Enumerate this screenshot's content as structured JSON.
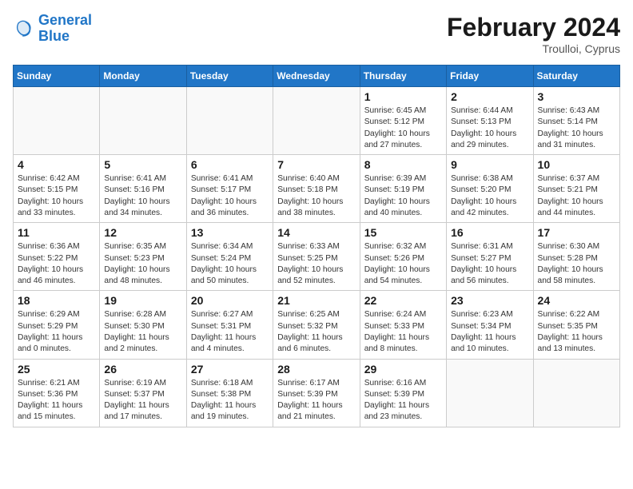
{
  "header": {
    "logo_line1": "General",
    "logo_line2": "Blue",
    "month_year": "February 2024",
    "location": "Troulloi, Cyprus"
  },
  "days_of_week": [
    "Sunday",
    "Monday",
    "Tuesday",
    "Wednesday",
    "Thursday",
    "Friday",
    "Saturday"
  ],
  "weeks": [
    [
      {
        "day": "",
        "info": ""
      },
      {
        "day": "",
        "info": ""
      },
      {
        "day": "",
        "info": ""
      },
      {
        "day": "",
        "info": ""
      },
      {
        "day": "1",
        "info": "Sunrise: 6:45 AM\nSunset: 5:12 PM\nDaylight: 10 hours and 27 minutes."
      },
      {
        "day": "2",
        "info": "Sunrise: 6:44 AM\nSunset: 5:13 PM\nDaylight: 10 hours and 29 minutes."
      },
      {
        "day": "3",
        "info": "Sunrise: 6:43 AM\nSunset: 5:14 PM\nDaylight: 10 hours and 31 minutes."
      }
    ],
    [
      {
        "day": "4",
        "info": "Sunrise: 6:42 AM\nSunset: 5:15 PM\nDaylight: 10 hours and 33 minutes."
      },
      {
        "day": "5",
        "info": "Sunrise: 6:41 AM\nSunset: 5:16 PM\nDaylight: 10 hours and 34 minutes."
      },
      {
        "day": "6",
        "info": "Sunrise: 6:41 AM\nSunset: 5:17 PM\nDaylight: 10 hours and 36 minutes."
      },
      {
        "day": "7",
        "info": "Sunrise: 6:40 AM\nSunset: 5:18 PM\nDaylight: 10 hours and 38 minutes."
      },
      {
        "day": "8",
        "info": "Sunrise: 6:39 AM\nSunset: 5:19 PM\nDaylight: 10 hours and 40 minutes."
      },
      {
        "day": "9",
        "info": "Sunrise: 6:38 AM\nSunset: 5:20 PM\nDaylight: 10 hours and 42 minutes."
      },
      {
        "day": "10",
        "info": "Sunrise: 6:37 AM\nSunset: 5:21 PM\nDaylight: 10 hours and 44 minutes."
      }
    ],
    [
      {
        "day": "11",
        "info": "Sunrise: 6:36 AM\nSunset: 5:22 PM\nDaylight: 10 hours and 46 minutes."
      },
      {
        "day": "12",
        "info": "Sunrise: 6:35 AM\nSunset: 5:23 PM\nDaylight: 10 hours and 48 minutes."
      },
      {
        "day": "13",
        "info": "Sunrise: 6:34 AM\nSunset: 5:24 PM\nDaylight: 10 hours and 50 minutes."
      },
      {
        "day": "14",
        "info": "Sunrise: 6:33 AM\nSunset: 5:25 PM\nDaylight: 10 hours and 52 minutes."
      },
      {
        "day": "15",
        "info": "Sunrise: 6:32 AM\nSunset: 5:26 PM\nDaylight: 10 hours and 54 minutes."
      },
      {
        "day": "16",
        "info": "Sunrise: 6:31 AM\nSunset: 5:27 PM\nDaylight: 10 hours and 56 minutes."
      },
      {
        "day": "17",
        "info": "Sunrise: 6:30 AM\nSunset: 5:28 PM\nDaylight: 10 hours and 58 minutes."
      }
    ],
    [
      {
        "day": "18",
        "info": "Sunrise: 6:29 AM\nSunset: 5:29 PM\nDaylight: 11 hours and 0 minutes."
      },
      {
        "day": "19",
        "info": "Sunrise: 6:28 AM\nSunset: 5:30 PM\nDaylight: 11 hours and 2 minutes."
      },
      {
        "day": "20",
        "info": "Sunrise: 6:27 AM\nSunset: 5:31 PM\nDaylight: 11 hours and 4 minutes."
      },
      {
        "day": "21",
        "info": "Sunrise: 6:25 AM\nSunset: 5:32 PM\nDaylight: 11 hours and 6 minutes."
      },
      {
        "day": "22",
        "info": "Sunrise: 6:24 AM\nSunset: 5:33 PM\nDaylight: 11 hours and 8 minutes."
      },
      {
        "day": "23",
        "info": "Sunrise: 6:23 AM\nSunset: 5:34 PM\nDaylight: 11 hours and 10 minutes."
      },
      {
        "day": "24",
        "info": "Sunrise: 6:22 AM\nSunset: 5:35 PM\nDaylight: 11 hours and 13 minutes."
      }
    ],
    [
      {
        "day": "25",
        "info": "Sunrise: 6:21 AM\nSunset: 5:36 PM\nDaylight: 11 hours and 15 minutes."
      },
      {
        "day": "26",
        "info": "Sunrise: 6:19 AM\nSunset: 5:37 PM\nDaylight: 11 hours and 17 minutes."
      },
      {
        "day": "27",
        "info": "Sunrise: 6:18 AM\nSunset: 5:38 PM\nDaylight: 11 hours and 19 minutes."
      },
      {
        "day": "28",
        "info": "Sunrise: 6:17 AM\nSunset: 5:39 PM\nDaylight: 11 hours and 21 minutes."
      },
      {
        "day": "29",
        "info": "Sunrise: 6:16 AM\nSunset: 5:39 PM\nDaylight: 11 hours and 23 minutes."
      },
      {
        "day": "",
        "info": ""
      },
      {
        "day": "",
        "info": ""
      }
    ]
  ]
}
